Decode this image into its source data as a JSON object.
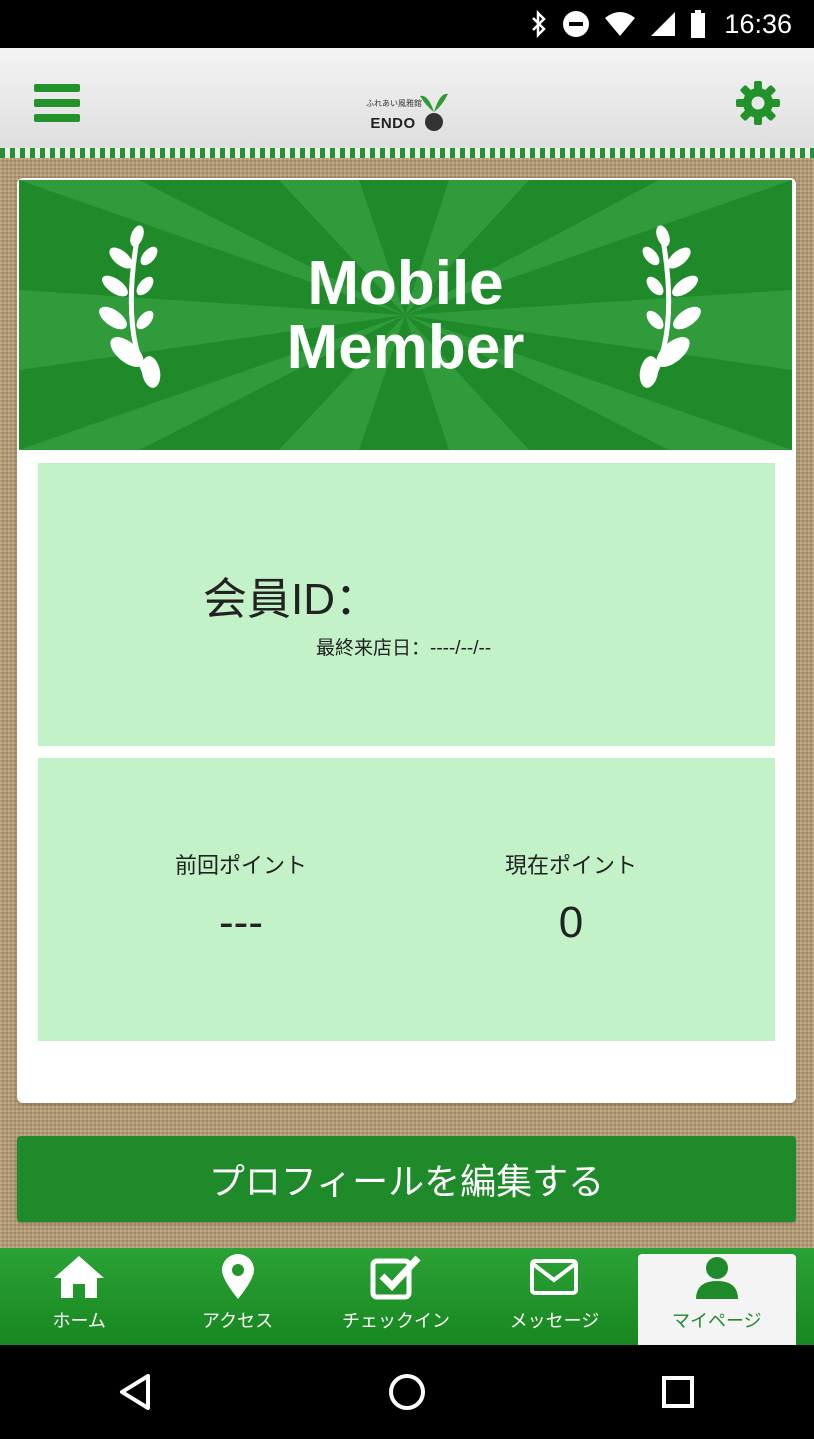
{
  "status_bar": {
    "time": "16:36",
    "icons": [
      "bluetooth-icon",
      "do-not-disturb-icon",
      "wifi-icon",
      "cell-signal-icon",
      "battery-icon"
    ]
  },
  "header": {
    "logo_small": "ふれあい風雅館",
    "logo_text": "ENDO",
    "menu_icon": "hamburger-menu-icon",
    "settings_icon": "gear-icon"
  },
  "banner": {
    "title_line1": "Mobile",
    "title_line2": "Member"
  },
  "member": {
    "id_label": "会員ID：",
    "last_visit_label": "最終来店日：----/--/--"
  },
  "points": {
    "previous_label": "前回ポイント",
    "previous_value": "---",
    "current_label": "現在ポイント",
    "current_value": "0"
  },
  "edit_profile": {
    "label": "プロフィールを編集する"
  },
  "tabs": [
    {
      "label": "ホーム",
      "icon": "home-icon"
    },
    {
      "label": "アクセス",
      "icon": "map-pin-icon"
    },
    {
      "label": "チェックイン",
      "icon": "checkbox-icon"
    },
    {
      "label": "メッセージ",
      "icon": "envelope-icon"
    },
    {
      "label": "マイページ",
      "icon": "user-icon",
      "active": true
    }
  ],
  "colors": {
    "primary_green": "#1f8a2a",
    "panel_green": "#c3f1c8"
  }
}
